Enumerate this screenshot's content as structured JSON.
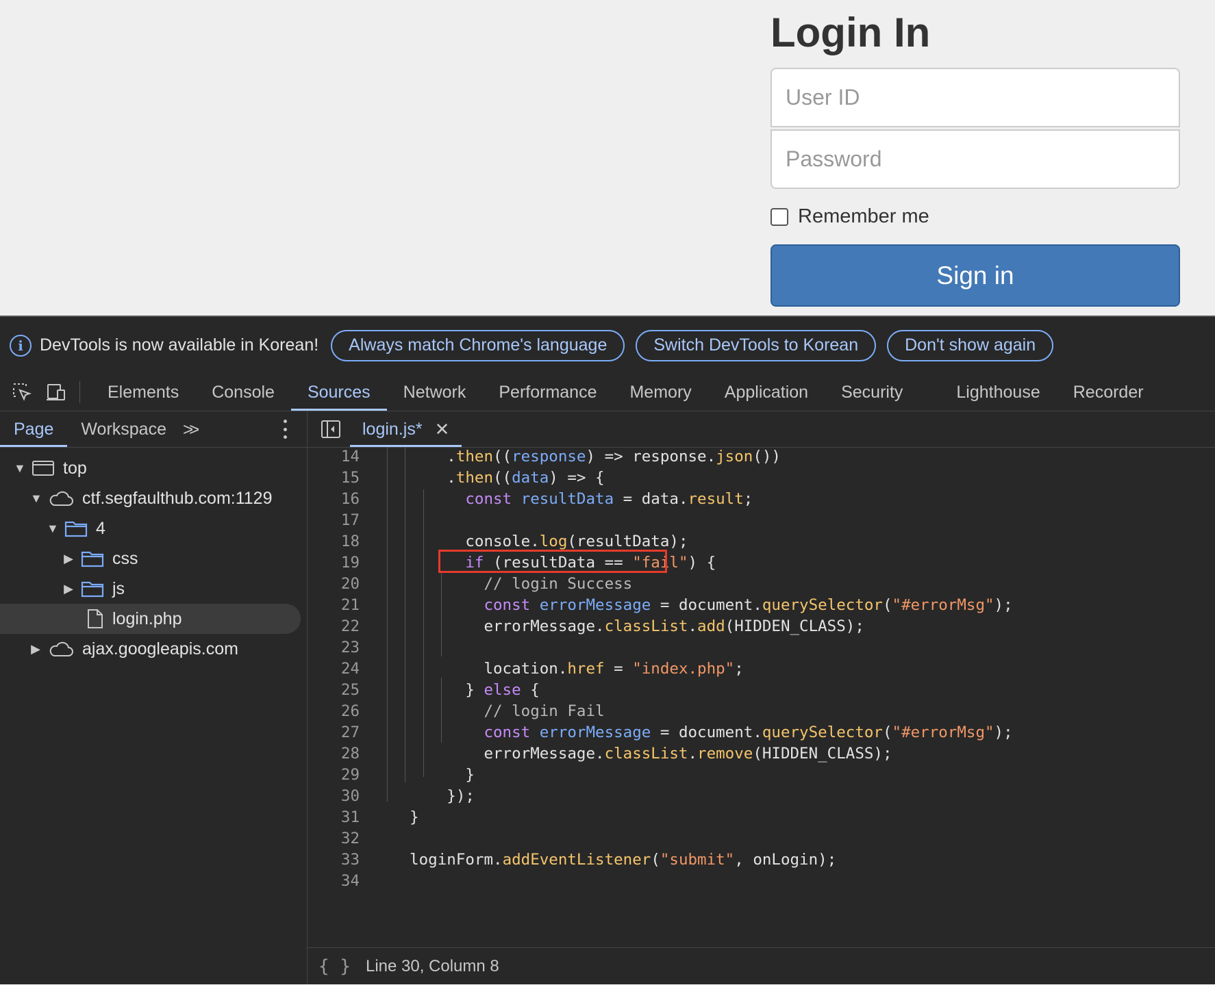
{
  "page": {
    "title": "Login In",
    "user_placeholder": "User ID",
    "password_placeholder": "Password",
    "remember_label": "Remember me",
    "signin_label": "Sign in"
  },
  "devtools": {
    "infobar": {
      "message": "DevTools is now available in Korean!",
      "buttons": [
        "Always match Chrome's language",
        "Switch DevTools to Korean",
        "Don't show again"
      ]
    },
    "tabs": [
      "Elements",
      "Console",
      "Sources",
      "Network",
      "Performance",
      "Memory",
      "Application",
      "Security",
      "Lighthouse",
      "Recorder"
    ],
    "active_tab": "Sources",
    "sidebar": {
      "tabs": [
        "Page",
        "Workspace"
      ],
      "more": ">>",
      "tree": {
        "top": "top",
        "host1": "ctf.segfaulthub.com:1129",
        "folder4": "4",
        "css": "css",
        "js": "js",
        "file": "login.php",
        "host2": "ajax.googleapis.com"
      }
    },
    "editor": {
      "file_tab": "login.js*",
      "close": "✕",
      "status": "Line 30, Column 8",
      "status_icon": "{ }"
    }
  }
}
